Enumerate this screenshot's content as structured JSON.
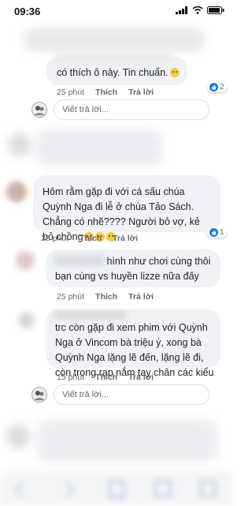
{
  "status": {
    "time": "09:36"
  },
  "comments": [
    {
      "text": "có thích ô này. Tin chuẩn.",
      "time": "25 phút",
      "like": "Thích",
      "reply": "Trả lời",
      "likes": "2"
    },
    {
      "text": "Hôm rằm gặp đi với cá sấu chúa Quỳnh Nga đi lễ ở chùa Tảo Sách. Chẳng có nhẽ???? Người bỏ vợ, kẻ bỏ chồng",
      "time": "28 phút",
      "like": "Thích",
      "reply": "Trả lời",
      "likes": "1"
    },
    {
      "text": "hình như chơi cùng thôi bạn cùng vs huyền lizze nữa đấy",
      "time": "25 phút",
      "like": "Thích",
      "reply": "Trả lời"
    },
    {
      "text": "trc còn gặp đi xem phim với Quỳnh Nga ở Vincom bà triệu ý, xong bà Quỳnh Nga lặng lẽ đến, lặng lẽ đi, còn trong rạp nắm tay chân các kiểu",
      "time": "15 phút",
      "like": "Thích",
      "reply": "Trả lời"
    }
  ],
  "reply_placeholder": "Viết trả lời...",
  "colors": {
    "like_blue": "#1877f2",
    "bubble": "#f0f2f5",
    "meta": "#65676b"
  }
}
